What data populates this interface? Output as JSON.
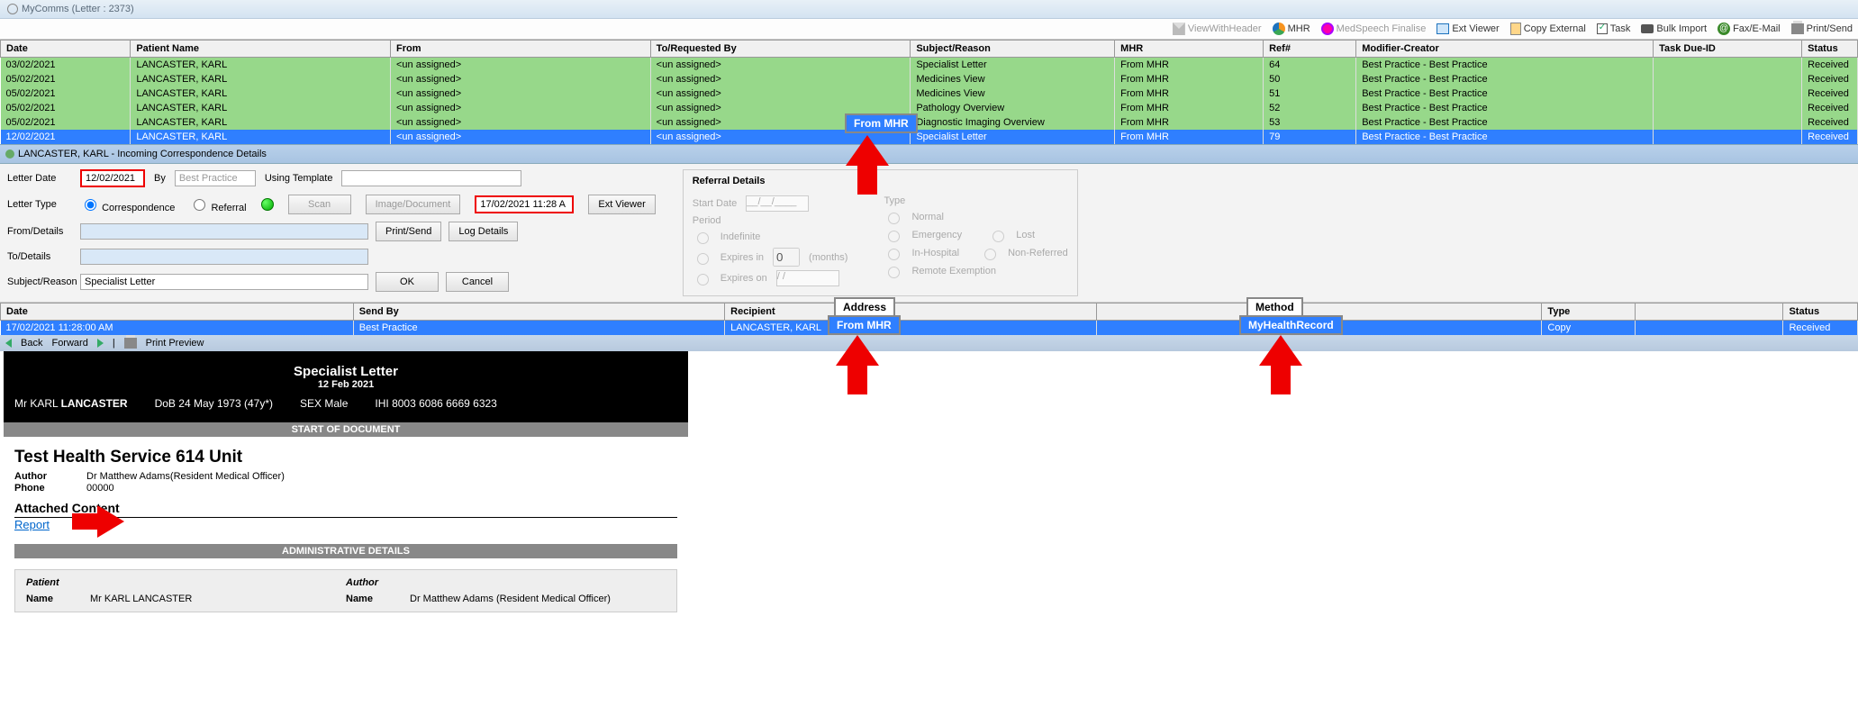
{
  "window": {
    "title": "MyComms (Letter : 2373)"
  },
  "toolbar": {
    "viewWithHeader": "ViewWithHeader",
    "mhr": "MHR",
    "medspeech": "MedSpeech Finalise",
    "extViewer": "Ext Viewer",
    "copyExternal": "Copy External",
    "task": "Task",
    "bulkImport": "Bulk Import",
    "faxEmail": "Fax/E-Mail",
    "printSend": "Print/Send"
  },
  "gridHeaders": {
    "date": "Date",
    "patient": "Patient Name",
    "from": "From",
    "to": "To/Requested By",
    "subject": "Subject/Reason",
    "mhr": "MHR",
    "ref": "Ref#",
    "mod": "Modifier-Creator",
    "task": "Task Due-ID",
    "status": "Status"
  },
  "rows": [
    {
      "date": "03/02/2021",
      "patient": "LANCASTER, KARL",
      "from": "<un assigned>",
      "to": "<un assigned>",
      "subject": "Specialist Letter",
      "mhr": "From MHR",
      "ref": "64",
      "mod": "Best Practice - Best Practice",
      "task": "",
      "status": "Received",
      "cls": "green"
    },
    {
      "date": "05/02/2021",
      "patient": "LANCASTER, KARL",
      "from": "<un assigned>",
      "to": "<un assigned>",
      "subject": "Medicines View",
      "mhr": "From MHR",
      "ref": "50",
      "mod": "Best Practice - Best Practice",
      "task": "",
      "status": "Received",
      "cls": "green"
    },
    {
      "date": "05/02/2021",
      "patient": "LANCASTER, KARL",
      "from": "<un assigned>",
      "to": "<un assigned>",
      "subject": "Medicines View",
      "mhr": "From MHR",
      "ref": "51",
      "mod": "Best Practice - Best Practice",
      "task": "",
      "status": "Received",
      "cls": "green"
    },
    {
      "date": "05/02/2021",
      "patient": "LANCASTER, KARL",
      "from": "<un assigned>",
      "to": "<un assigned>",
      "subject": "Pathology Overview",
      "mhr": "From MHR",
      "ref": "52",
      "mod": "Best Practice - Best Practice",
      "task": "",
      "status": "Received",
      "cls": "green"
    },
    {
      "date": "05/02/2021",
      "patient": "LANCASTER, KARL",
      "from": "<un assigned>",
      "to": "<un assigned>",
      "subject": "Diagnostic Imaging Overview",
      "mhr": "From MHR",
      "ref": "53",
      "mod": "Best Practice - Best Practice",
      "task": "",
      "status": "Received",
      "cls": "green"
    },
    {
      "date": "12/02/2021",
      "patient": "LANCASTER, KARL",
      "from": "<un assigned>",
      "to": "<un assigned>",
      "subject": "Specialist Letter",
      "mhr": "From MHR",
      "ref": "79",
      "mod": "Best Practice - Best Practice",
      "task": "",
      "status": "Received",
      "cls": "blue"
    }
  ],
  "subheader": {
    "text": "LANCASTER, KARL - Incoming Correspondence Details"
  },
  "form": {
    "letterDateLabel": "Letter Date",
    "letterDate": "12/02/2021",
    "byLabel": "By",
    "by": "Best Practice",
    "usingTemplateLabel": "Using Template",
    "letterTypeLabel": "Letter Type",
    "correspondence": "Correspondence",
    "referral": "Referral",
    "scan": "Scan",
    "imageDoc": "Image/Document",
    "timestamp": "17/02/2021 11:28 A",
    "extViewer": "Ext Viewer",
    "fromDetails": "From/Details",
    "toDetails": "To/Details",
    "subjectReason": "Subject/Reason",
    "subjectValue": "Specialist Letter",
    "printSend": "Print/Send",
    "logDetails": "Log Details",
    "ok": "OK",
    "cancel": "Cancel"
  },
  "referral": {
    "title": "Referral Details",
    "startDate": "Start Date",
    "period": "Period",
    "indefinite": "Indefinite",
    "expiresIn": "Expires in",
    "months": "(months)",
    "expiresOn": "Expires on",
    "type": "Type",
    "normal": "Normal",
    "emergency": "Emergency",
    "lost": "Lost",
    "inHospital": "In-Hospital",
    "nonReferred": "Non-Referred",
    "remote": "Remote Exemption",
    "dateMask": "__/__/____",
    "slashMask": "  /  /",
    "zero": "0"
  },
  "logHeaders": {
    "date": "Date",
    "sendBy": "Send By",
    "recipient": "Recipient",
    "address": "Address",
    "type": "Type",
    "method": "Method",
    "status": "Status"
  },
  "logRow": {
    "date": "17/02/2021 11:28:00 AM",
    "sendBy": "Best Practice",
    "recipient": "LANCASTER, KARL",
    "address": "From MHR",
    "type": "Copy",
    "method": "MyHealthRecord",
    "status": "Received"
  },
  "nav": {
    "back": "Back",
    "forward": "Forward",
    "printPreview": "Print Preview"
  },
  "doc": {
    "title": "Specialist Letter",
    "date": "12 Feb 2021",
    "patientLine1": "Mr KARL",
    "patientLine2": "LANCASTER",
    "dobLabel": "DoB",
    "dob": "24 May 1973 (47y*)",
    "sexLabel": "SEX",
    "sex": "Male",
    "ihiLabel": "IHI",
    "ihi": "8003 6086 6669 6323",
    "startOfDoc": "START OF DOCUMENT",
    "service": "Test Health Service 614 Unit",
    "authorLabel": "Author",
    "author": "Dr Matthew Adams(Resident Medical Officer)",
    "phoneLabel": "Phone",
    "phone": "00000",
    "attached": "Attached Content",
    "report": "Report",
    "adminDetails": "ADMINISTRATIVE DETAILS",
    "patientHdr": "Patient",
    "authorHdr": "Author",
    "name": "Name",
    "adminPatient": "Mr KARL LANCASTER",
    "adminAuthor": "Dr Matthew Adams (Resident Medical Officer)"
  },
  "callouts": {
    "fromMhr": "From MHR",
    "address": "Address",
    "method": "Method"
  }
}
